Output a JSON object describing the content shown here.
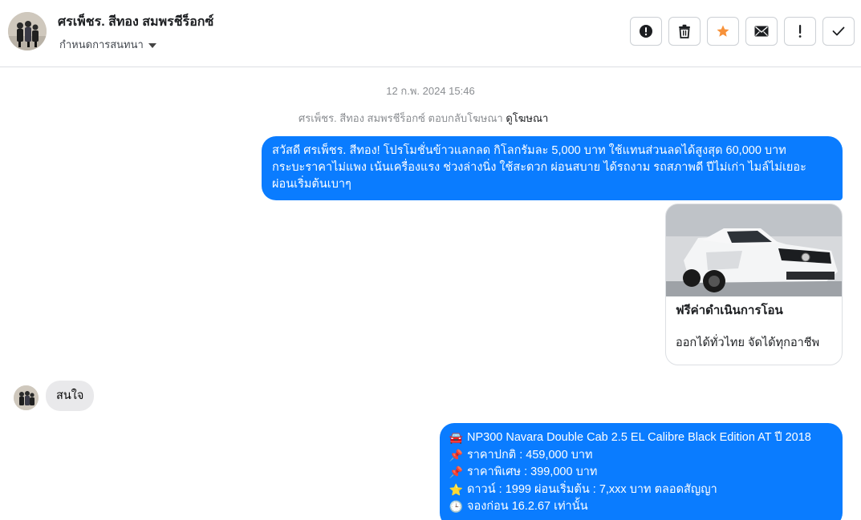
{
  "header": {
    "contact_name": "ศรเพ็ชร. สีทอง สมพรชีร็อกซ์",
    "subtitle": "กำหนดการสนทนา",
    "actions": [
      {
        "name": "report-button",
        "icon": "exclamation-circle-icon"
      },
      {
        "name": "delete-button",
        "icon": "trash-icon"
      },
      {
        "name": "star-button",
        "icon": "star-icon",
        "color": "#f7923a"
      },
      {
        "name": "mark-unread-button",
        "icon": "envelope-icon"
      },
      {
        "name": "important-button",
        "icon": "exclamation-icon"
      },
      {
        "name": "done-button",
        "icon": "check-icon"
      }
    ]
  },
  "chat": {
    "timestamp": "12 ก.พ. 2024 15:46",
    "ad_reply_text": "ศรเพ็ชร. สีทอง สมพรชีร็อกซ์ ตอบกลับโฆษณา",
    "ad_reply_link": "ดูโฆษณา",
    "messages": [
      {
        "direction": "outgoing",
        "lines": [
          "สวัสดี ศรเพ็ชร. สีทอง! โปรโมชั่นข้าวแลกลด กิโลกรัมละ 5,000 บาท ใช้แทนส่วนลดได้สูงสุด 60,000 บาท",
          "กระบะราคาไม่แพง เน้นเครื่องแรง ช่วงล่างนิ่ง ใช้สะดวก ผ่อนสบาย ได้รถงาม รถสภาพดี ปีไม่เก่า ไมล์ไม่เยอะ",
          "ผ่อนเริ่มต้นเบาๆ"
        ]
      },
      {
        "direction": "outgoing",
        "type": "card",
        "image_alt": "white pickup truck",
        "title": "ฟรีค่าดำเนินการโอน",
        "description": "ออกได้ทั่วไทย จัดได้ทุกอาชีพ"
      },
      {
        "direction": "incoming",
        "text": "สนใจ"
      },
      {
        "direction": "outgoing",
        "rows": [
          {
            "emoji": "🚘",
            "text": "NP300 Navara Double Cab 2.5 EL Calibre Black Edition AT ปี 2018"
          },
          {
            "emoji": "📌",
            "text": "ราคาปกติ : 459,000 บาท"
          },
          {
            "emoji": "📌",
            "text": "ราคาพิเศษ : 399,000 บาท"
          },
          {
            "emoji": "⭐",
            "text": "ดาวน์ : 1999  ผ่อนเริ่มต้น : 7,xxx บาท ตลอดสัญญา"
          },
          {
            "emoji": "🕒",
            "text": "จองก่อน 16.2.67 เท่านั้น"
          }
        ]
      }
    ]
  },
  "colors": {
    "outgoing_bubble": "#0a7cff",
    "incoming_bubble": "#e9e9eb",
    "star": "#f7923a"
  }
}
